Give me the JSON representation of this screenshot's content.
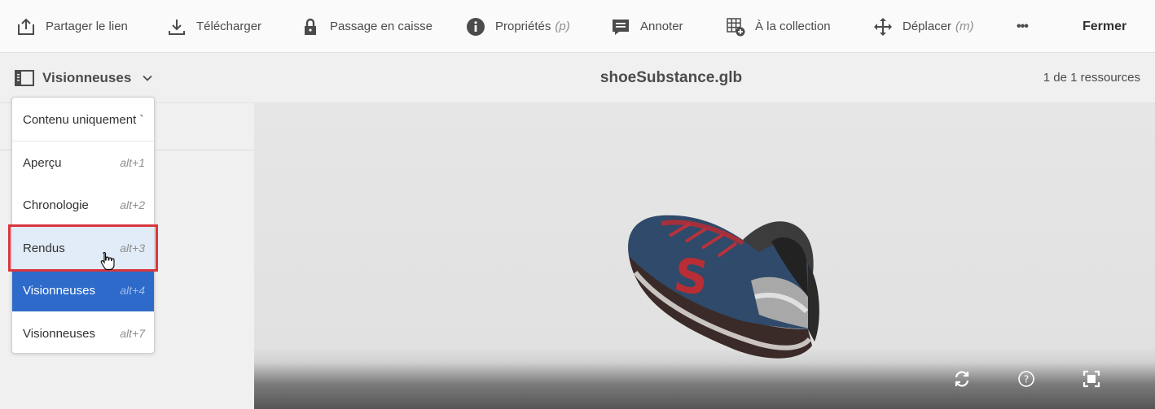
{
  "toolbar": {
    "share_label": "Partager le lien",
    "download_label": "Télécharger",
    "checkout_label": "Passage en caisse",
    "properties_label": "Propriétés",
    "properties_hint": "(p)",
    "annotate_label": "Annoter",
    "collection_label": "À la collection",
    "move_label": "Déplacer",
    "move_hint": "(m)",
    "more_label": "•••",
    "close_label": "Fermer"
  },
  "subbar": {
    "viewer_switch_label": "Visionneuses",
    "file_title": "shoeSubstance.glb",
    "counter": "1 de 1 ressources"
  },
  "menu": {
    "items": [
      {
        "label": "Contenu uniquement `",
        "shortcut": ""
      },
      {
        "label": "Aperçu",
        "shortcut": "alt+1"
      },
      {
        "label": "Chronologie",
        "shortcut": "alt+2"
      },
      {
        "label": "Rendus",
        "shortcut": "alt+3"
      },
      {
        "label": "Visionneuses",
        "shortcut": "alt+4"
      },
      {
        "label": "Visionneuses",
        "shortcut": "alt+7"
      }
    ],
    "hovered_item": "Rendus",
    "selected_item": "Visionneuses"
  },
  "viewer": {
    "controls": [
      "reset-view-icon",
      "help-icon",
      "fullscreen-icon"
    ]
  },
  "colors": {
    "accent": "#2d6ac9",
    "highlight_border": "#d9363e",
    "hover_bg": "#e2ecf8"
  }
}
